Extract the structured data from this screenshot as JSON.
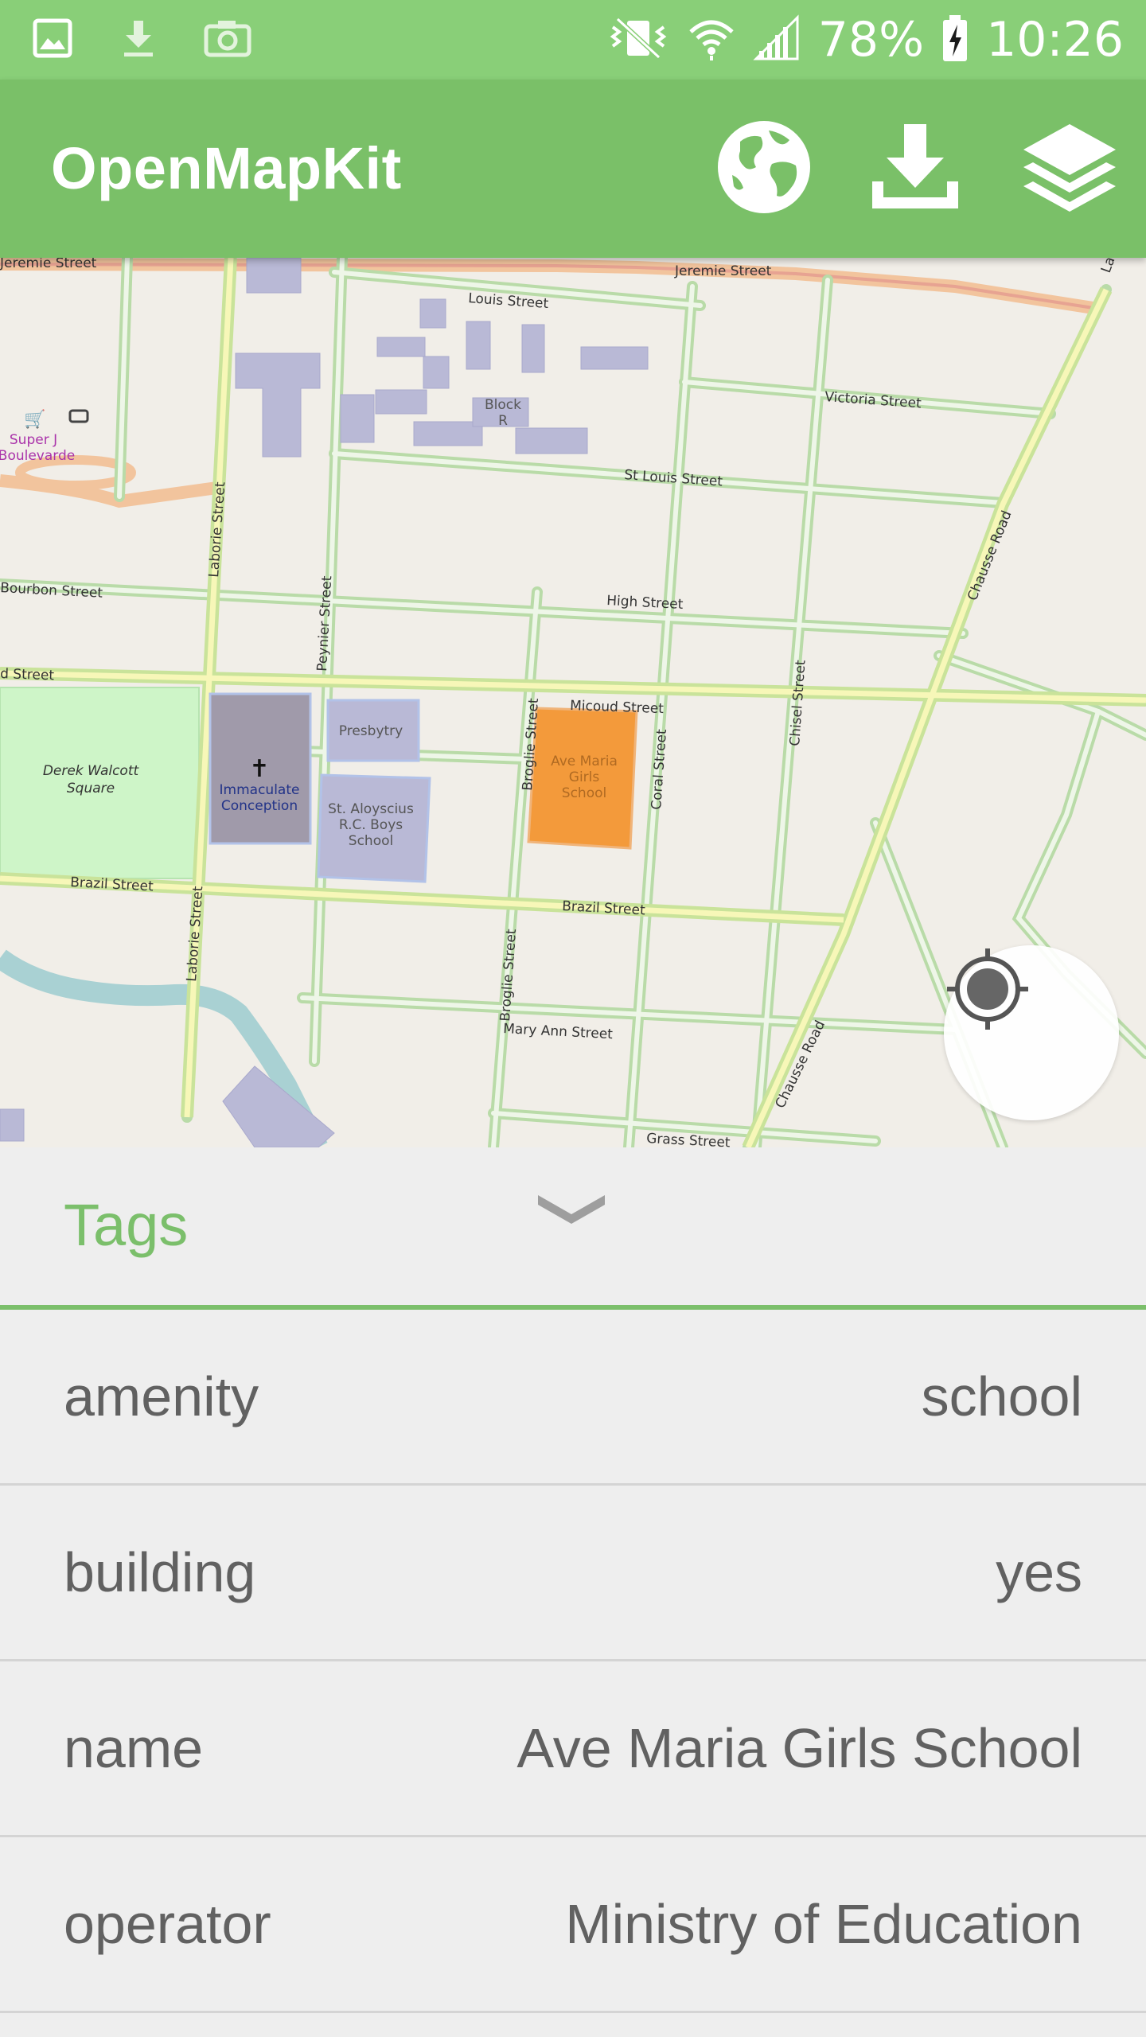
{
  "status_bar": {
    "battery": "78%",
    "time": "10:26"
  },
  "app_bar": {
    "title": "OpenMapKit",
    "icons": [
      "globe-icon",
      "download-icon",
      "layers-icon"
    ]
  },
  "map": {
    "streets": {
      "jeremie": "Jeremie Street",
      "jeremie_left": "Jeremie Street",
      "louis": "Louis Street",
      "victoria": "Victoria Street",
      "st_louis": "St Louis Street",
      "bourbon": "Bourbon Street",
      "high": "High Street",
      "micoud": "Micoud Street",
      "left_street": "d Street",
      "brazil_left": "Brazil Street",
      "brazil_right": "Brazil Street",
      "mary_ann": "Mary Ann Street",
      "grass": "Grass Street",
      "laborie_top": "Laborie Street",
      "laborie_bottom": "Laborie Street",
      "peynier": "Peynier Street",
      "broglie_top": "Broglie Street",
      "broglie_bottom": "Broglie Street",
      "coral": "Coral Street",
      "chisel": "Chisel Street",
      "chausse_top": "Chausse Road",
      "chausse_bottom": "Chausse Road",
      "la": "La"
    },
    "pois": {
      "block_r_1": "Block",
      "block_r_2": "R",
      "super_j_1": "Super J",
      "super_j_2": "Boulevarde",
      "derek_1": "Derek Walcott",
      "derek_2": "Square",
      "church_1": "Immaculate",
      "church_2": "Conception",
      "presbytry": "Presbytry",
      "aloyscius_1": "St. Aloyscius",
      "aloyscius_2": "R.C. Boys",
      "aloyscius_3": "School",
      "ave_maria_1": "Ave Maria",
      "ave_maria_2": "Girls",
      "ave_maria_3": "School"
    },
    "colors": {
      "background": "#f1eee8",
      "road_casing": "#b9dba8",
      "road_fill": "#eef6e8",
      "building": "#b9b9d6",
      "selected_building": "#f39a3b",
      "park": "#cef5c8",
      "river": "#a9d1d3"
    }
  },
  "tags_panel": {
    "title": "Tags",
    "rows": [
      {
        "key": "amenity",
        "value": "school"
      },
      {
        "key": "building",
        "value": "yes"
      },
      {
        "key": "name",
        "value": "Ave Maria Girls School"
      },
      {
        "key": "operator",
        "value": "Ministry of Education"
      }
    ]
  },
  "colors": {
    "status_bar": "#89cf78",
    "app_bar": "#7ac068",
    "accent": "#7bbf6b",
    "panel_bg": "#eeeeee",
    "text": "#616161"
  }
}
